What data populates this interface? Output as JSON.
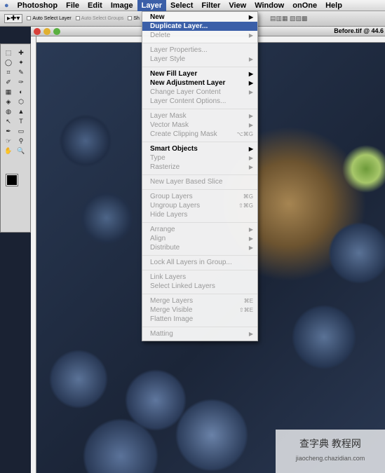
{
  "menubar": {
    "items": [
      "Photoshop",
      "File",
      "Edit",
      "Image",
      "Layer",
      "Select",
      "Filter",
      "View",
      "Window",
      "onOne",
      "Help"
    ],
    "active": "Layer"
  },
  "options": {
    "auto_select_layer": "Auto Select Layer",
    "auto_select_groups": "Auto Select Groups",
    "show": "Sh"
  },
  "document": {
    "title": "Before.tif @ 44.6"
  },
  "menu": {
    "items": [
      {
        "label": "New",
        "enabled": true,
        "submenu": true
      },
      {
        "label": "Duplicate Layer...",
        "enabled": true,
        "highlighted": true
      },
      {
        "label": "Delete",
        "enabled": false,
        "submenu": true
      },
      {
        "sep": true
      },
      {
        "label": "Layer Properties...",
        "enabled": false
      },
      {
        "label": "Layer Style",
        "enabled": false,
        "submenu": true
      },
      {
        "sep": true
      },
      {
        "label": "New Fill Layer",
        "enabled": true,
        "submenu": true
      },
      {
        "label": "New Adjustment Layer",
        "enabled": true,
        "submenu": true
      },
      {
        "label": "Change Layer Content",
        "enabled": false,
        "submenu": true
      },
      {
        "label": "Layer Content Options...",
        "enabled": false
      },
      {
        "sep": true
      },
      {
        "label": "Layer Mask",
        "enabled": false,
        "submenu": true
      },
      {
        "label": "Vector Mask",
        "enabled": false,
        "submenu": true
      },
      {
        "label": "Create Clipping Mask",
        "enabled": false,
        "shortcut": "⌥⌘G"
      },
      {
        "sep": true
      },
      {
        "label": "Smart Objects",
        "enabled": true,
        "submenu": true
      },
      {
        "label": "Type",
        "enabled": false,
        "submenu": true
      },
      {
        "label": "Rasterize",
        "enabled": false,
        "submenu": true
      },
      {
        "sep": true
      },
      {
        "label": "New Layer Based Slice",
        "enabled": false
      },
      {
        "sep": true
      },
      {
        "label": "Group Layers",
        "enabled": false,
        "shortcut": "⌘G"
      },
      {
        "label": "Ungroup Layers",
        "enabled": false,
        "shortcut": "⇧⌘G"
      },
      {
        "label": "Hide Layers",
        "enabled": false
      },
      {
        "sep": true
      },
      {
        "label": "Arrange",
        "enabled": false,
        "submenu": true
      },
      {
        "label": "Align",
        "enabled": false,
        "submenu": true
      },
      {
        "label": "Distribute",
        "enabled": false,
        "submenu": true
      },
      {
        "sep": true
      },
      {
        "label": "Lock All Layers in Group...",
        "enabled": false
      },
      {
        "sep": true
      },
      {
        "label": "Link Layers",
        "enabled": false
      },
      {
        "label": "Select Linked Layers",
        "enabled": false
      },
      {
        "sep": true
      },
      {
        "label": "Merge Layers",
        "enabled": false,
        "shortcut": "⌘E"
      },
      {
        "label": "Merge Visible",
        "enabled": false,
        "shortcut": "⇧⌘E"
      },
      {
        "label": "Flatten Image",
        "enabled": false
      },
      {
        "sep": true
      },
      {
        "label": "Matting",
        "enabled": false,
        "submenu": true
      }
    ]
  },
  "watermark": {
    "line1": "查字典 教程网",
    "line2": "jiaocheng.chazidian.com"
  },
  "colors": {
    "highlight": "#3b5fa8"
  }
}
